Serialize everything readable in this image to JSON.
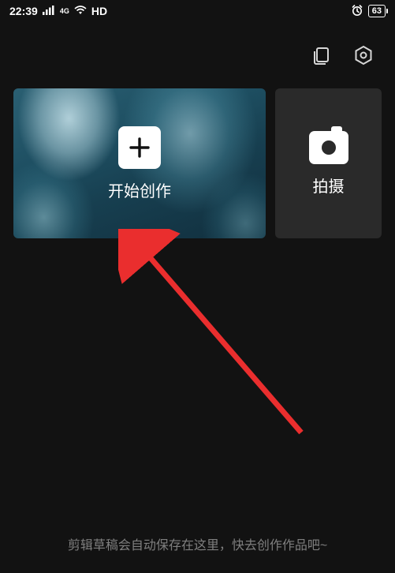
{
  "status": {
    "time": "22:39",
    "network_type": "4G",
    "hd_label": "HD",
    "battery_percent": "63"
  },
  "cards": {
    "create": {
      "label": "开始创作"
    },
    "shoot": {
      "label": "拍摄"
    }
  },
  "hint_text": "剪辑草稿会自动保存在这里，快去创作作品吧~",
  "colors": {
    "accent_red": "#ff3757",
    "accent_cyan": "#3cd6c7",
    "arrow": "#ea2e2e"
  }
}
